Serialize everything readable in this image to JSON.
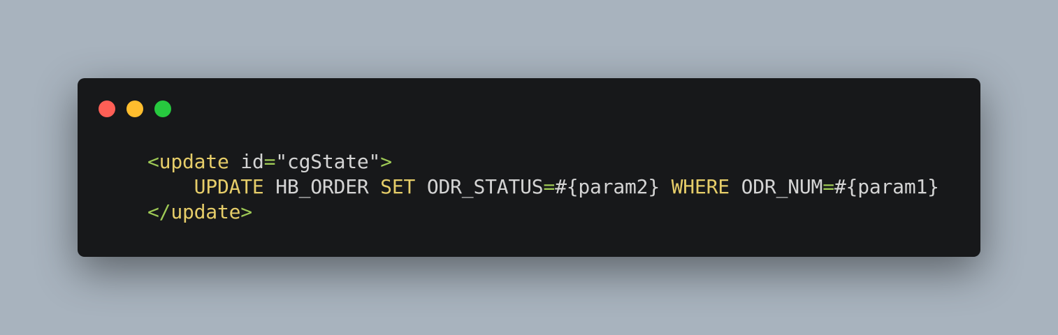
{
  "window": {
    "controls": [
      {
        "name": "close-button",
        "color": "#ff5f56"
      },
      {
        "name": "minimize-button",
        "color": "#ffbd2e"
      },
      {
        "name": "maximize-button",
        "color": "#27c93f"
      }
    ]
  },
  "colors": {
    "tag": "#e6cd69",
    "punct": "#9fca56",
    "text": "#d4d4d4",
    "keyword": "#e6cd69"
  },
  "code": {
    "lines": [
      [
        {
          "t": "<",
          "k": "punct"
        },
        {
          "t": "update",
          "k": "tag"
        },
        {
          "t": " id",
          "k": "text"
        },
        {
          "t": "=",
          "k": "punct"
        },
        {
          "t": "\"cgState\"",
          "k": "text"
        },
        {
          "t": ">",
          "k": "punct"
        }
      ],
      [
        {
          "t": "    ",
          "k": "text"
        },
        {
          "t": "UPDATE",
          "k": "keyword"
        },
        {
          "t": " HB_ORDER ",
          "k": "text"
        },
        {
          "t": "SET",
          "k": "keyword"
        },
        {
          "t": " ODR_STATUS",
          "k": "text"
        },
        {
          "t": "=",
          "k": "punct"
        },
        {
          "t": "#{param2} ",
          "k": "text"
        },
        {
          "t": "WHERE",
          "k": "keyword"
        },
        {
          "t": " ODR_NUM",
          "k": "text"
        },
        {
          "t": "=",
          "k": "punct"
        },
        {
          "t": "#{param1}",
          "k": "text"
        }
      ],
      [
        {
          "t": "</",
          "k": "punct"
        },
        {
          "t": "update",
          "k": "tag"
        },
        {
          "t": ">",
          "k": "punct"
        }
      ]
    ]
  }
}
